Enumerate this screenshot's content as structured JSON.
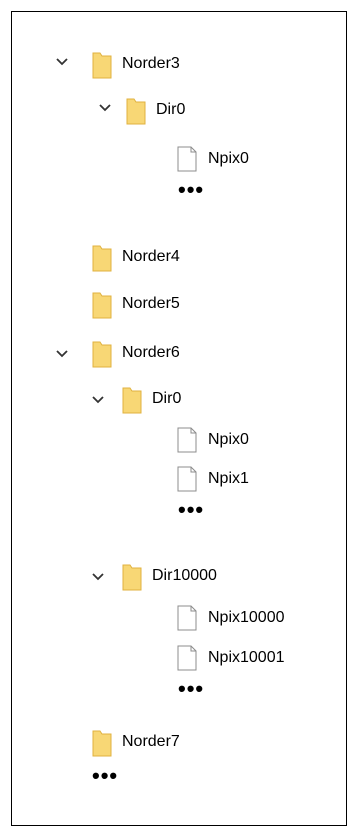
{
  "tree": {
    "norder3": {
      "label": "Norder3",
      "expanded": true
    },
    "norder3_dir0": {
      "label": "Dir0",
      "expanded": true
    },
    "norder3_dir0_npix0": {
      "label": "Npix0"
    },
    "norder3_dir0_more": {
      "label": "•••"
    },
    "norder4": {
      "label": "Norder4"
    },
    "norder5": {
      "label": "Norder5"
    },
    "norder6": {
      "label": "Norder6",
      "expanded": true
    },
    "norder6_dir0": {
      "label": "Dir0",
      "expanded": true
    },
    "norder6_dir0_npix0": {
      "label": "Npix0"
    },
    "norder6_dir0_npix1": {
      "label": "Npix1"
    },
    "norder6_dir0_more": {
      "label": "•••"
    },
    "norder6_dir10000": {
      "label": "Dir10000",
      "expanded": true
    },
    "norder6_dir10000_npix10000": {
      "label": "Npix10000"
    },
    "norder6_dir10000_npix10001": {
      "label": "Npix10001"
    },
    "norder6_dir10000_more": {
      "label": "•••"
    },
    "norder7": {
      "label": "Norder7"
    },
    "root_more": {
      "label": "•••"
    }
  },
  "icons": {
    "folder": "folder-icon",
    "file": "file-icon",
    "chevron": "chevron-down-icon"
  },
  "colors": {
    "folder_fill": "#F8D775",
    "folder_stroke": "#E0B23F",
    "file_fill": "#FFFFFF",
    "file_stroke": "#8C8C8C",
    "chevron": "#333333"
  }
}
